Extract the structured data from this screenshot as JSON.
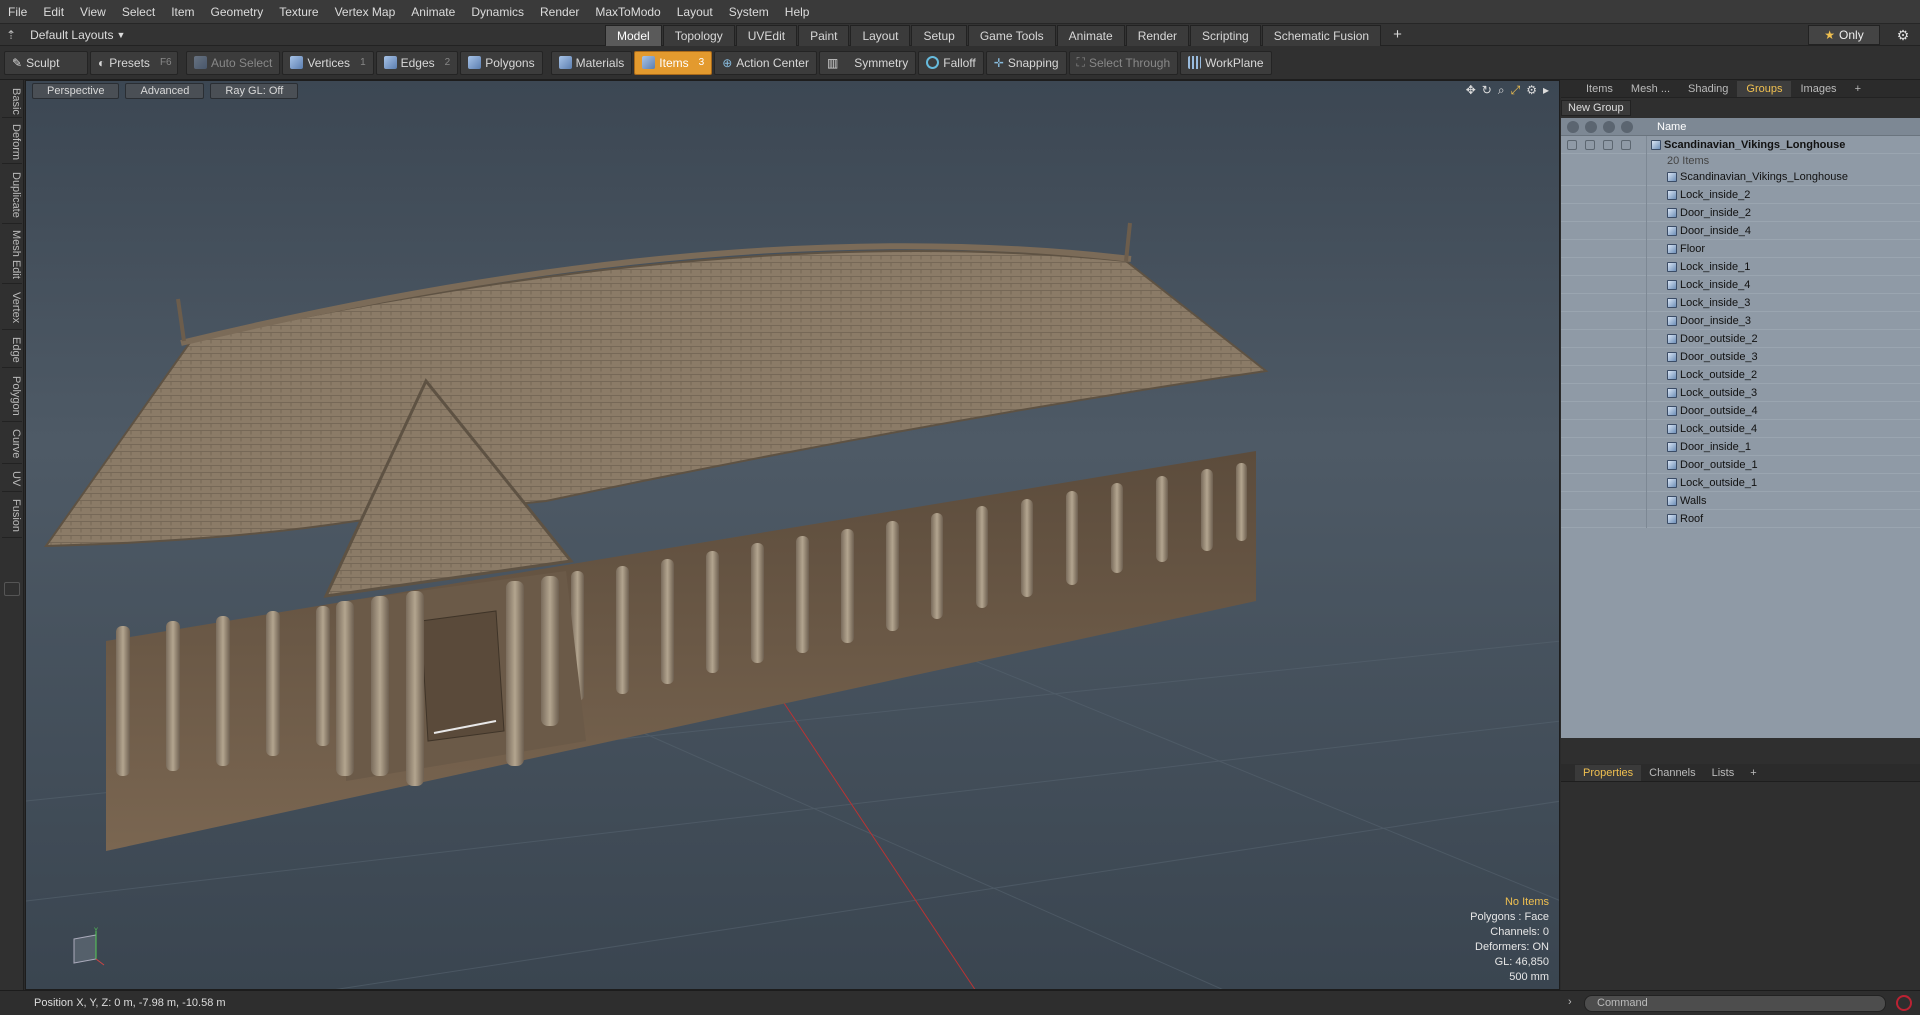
{
  "menubar": {
    "items": [
      "File",
      "Edit",
      "View",
      "Select",
      "Item",
      "Geometry",
      "Texture",
      "Vertex Map",
      "Animate",
      "Dynamics",
      "Render",
      "MaxToModo",
      "Layout",
      "System",
      "Help"
    ]
  },
  "layoutbar": {
    "layout_select": "Default Layouts",
    "tabs": [
      "Model",
      "Topology",
      "UVEdit",
      "Paint",
      "Layout",
      "Setup",
      "Game Tools",
      "Animate",
      "Render",
      "Scripting",
      "Schematic Fusion"
    ],
    "active_tab": "Model",
    "only_label": "Only"
  },
  "toolbar": {
    "sculpt": "Sculpt",
    "presets": "Presets",
    "presets_key": "F6",
    "auto_select": "Auto Select",
    "vertices": "Vertices",
    "vertices_count": "1",
    "edges": "Edges",
    "edges_count": "2",
    "polygons": "Polygons",
    "materials": "Materials",
    "items": "Items",
    "items_count": "3",
    "action_center": "Action Center",
    "symmetry": "Symmetry",
    "falloff": "Falloff",
    "snapping": "Snapping",
    "select_through": "Select Through",
    "workplane": "WorkPlane"
  },
  "sidebar": {
    "tabs": [
      "Basic",
      "Deform",
      "Duplicate",
      "Mesh Edit",
      "Vertex",
      "Edge",
      "Polygon",
      "Curve",
      "UV",
      "Fusion"
    ]
  },
  "viewport": {
    "view_mode": "Perspective",
    "shading": "Advanced",
    "raygl": "Ray GL: Off",
    "stats": {
      "selection": "No Items",
      "polygons": "Polygons : Face",
      "channels": "Channels: 0",
      "deformers": "Deformers: ON",
      "gl": "GL: 46,850",
      "grid": "500 mm"
    }
  },
  "right_panel": {
    "tabs": [
      "Items",
      "Mesh ...",
      "Shading",
      "Groups",
      "Images"
    ],
    "active_tab": "Groups",
    "new_group": "New Group",
    "name_header": "Name",
    "group_name": "Scandinavian_Vikings_Longhouse",
    "group_count": "20 Items",
    "items": [
      "Scandinavian_Vikings_Longhouse",
      "Lock_inside_2",
      "Door_inside_2",
      "Door_inside_4",
      "Floor",
      "Lock_inside_1",
      "Lock_inside_4",
      "Lock_inside_3",
      "Door_inside_3",
      "Door_outside_2",
      "Door_outside_3",
      "Lock_outside_2",
      "Lock_outside_3",
      "Door_outside_4",
      "Lock_outside_4",
      "Door_inside_1",
      "Door_outside_1",
      "Lock_outside_1",
      "Walls",
      "Roof"
    ],
    "props_tabs": [
      "Properties",
      "Channels",
      "Lists"
    ],
    "props_active": "Properties"
  },
  "statusbar": {
    "position": "Position X, Y, Z:  0 m, -7.98 m, -10.58 m",
    "command_placeholder": "Command"
  }
}
